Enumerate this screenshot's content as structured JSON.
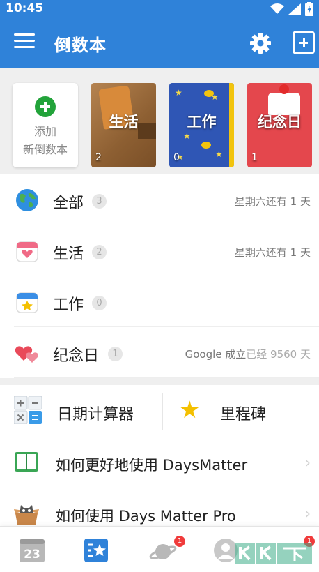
{
  "status_bar": {
    "time": "10:45"
  },
  "app_bar": {
    "title": "倒数本"
  },
  "shelf": {
    "new_book_line1": "添加",
    "new_book_line2": "新倒数本",
    "books": [
      {
        "title": "生活",
        "count": "2",
        "color": "#8d5f32"
      },
      {
        "title": "工作",
        "count": "0",
        "color": "#2f56b5"
      },
      {
        "title": "纪念日",
        "count": "1",
        "color": "#e4474d"
      }
    ]
  },
  "list": [
    {
      "icon": "globe-icon",
      "label": "全部",
      "badge": "3",
      "right": "星期六还有 1 天"
    },
    {
      "icon": "calendar-heart-icon",
      "label": "生活",
      "badge": "2",
      "right": "星期六还有 1 天"
    },
    {
      "icon": "calendar-star-icon",
      "label": "工作",
      "badge": "0",
      "right": ""
    },
    {
      "icon": "hearts-icon",
      "label": "纪念日",
      "badge": "1",
      "right_main": "Google 成立",
      "right_muted": "已经 9560 天"
    }
  ],
  "tools": {
    "calculator_label": "日期计算器",
    "milestone_label": "里程碑"
  },
  "help_items": [
    {
      "icon": "book-icon",
      "label": "如何更好地使用 DaysMatter"
    },
    {
      "icon": "cat-box-icon",
      "label": "如何使用 Days Matter Pro"
    }
  ],
  "bottom_nav": {
    "calendar_day": "23",
    "planet_badge": "1",
    "profile_badge": "1"
  },
  "colors": {
    "primary": "#2f82d9",
    "accent_green": "#22a33a",
    "badge_red": "#f03b3b"
  }
}
